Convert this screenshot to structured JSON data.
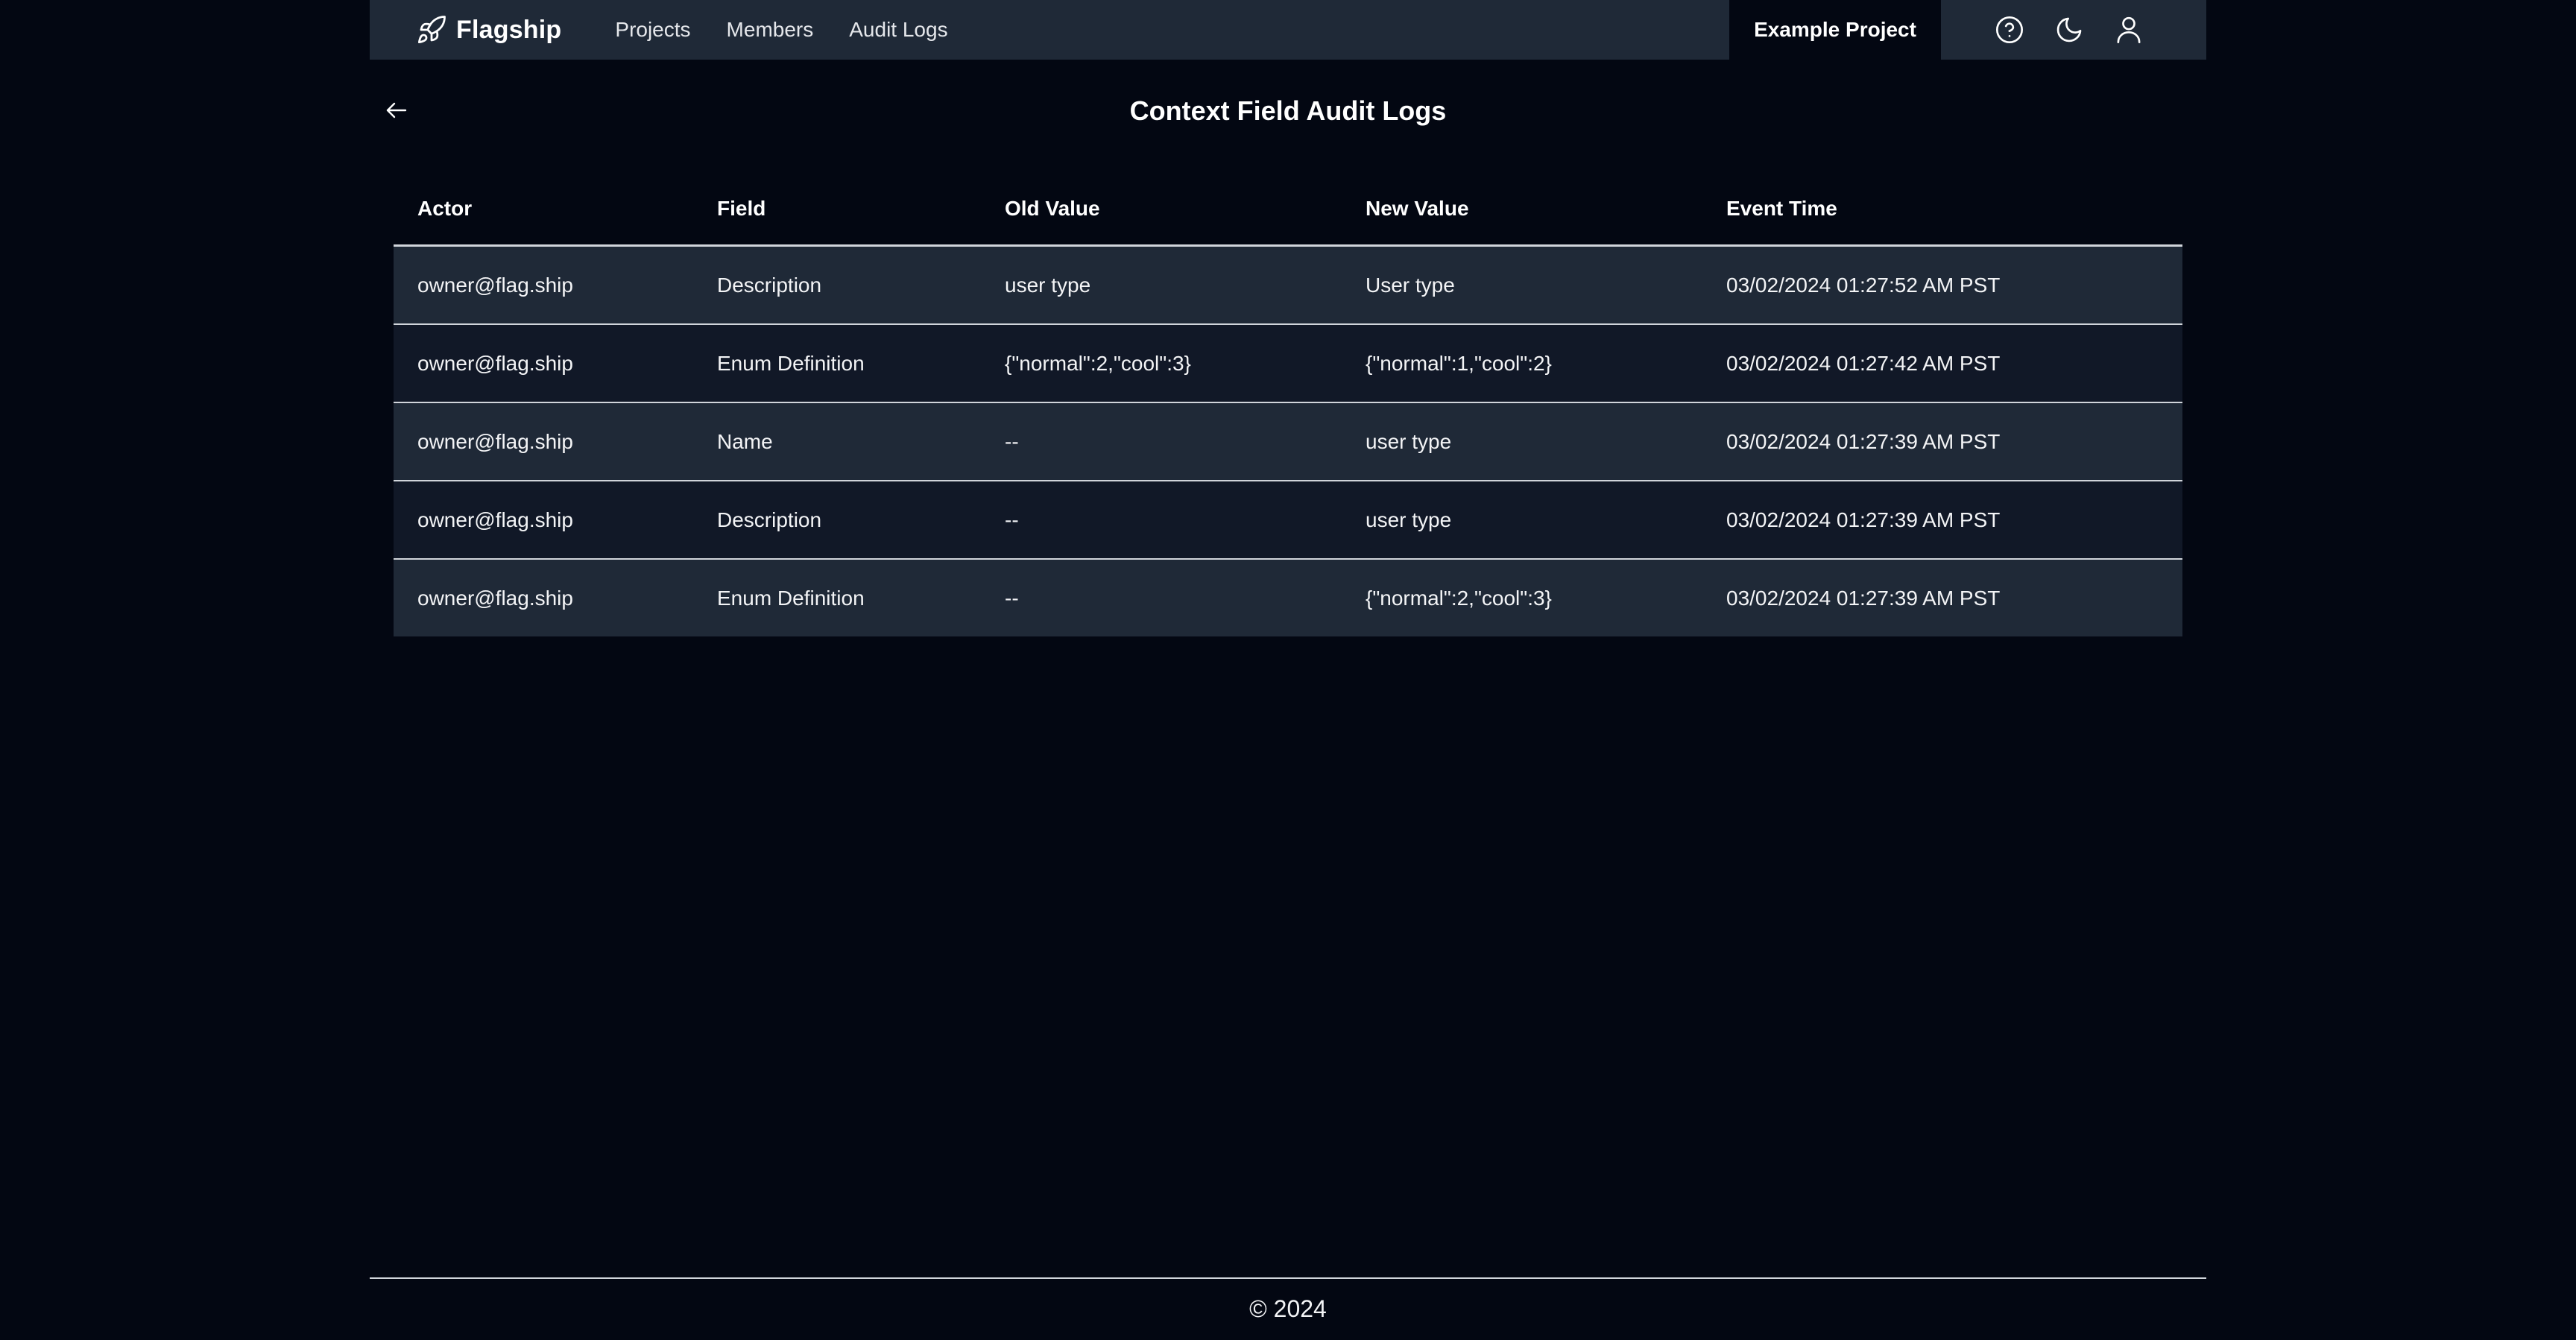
{
  "navbar": {
    "brand_name": "Flagship",
    "brand_icon": "rocket-icon",
    "links": [
      {
        "label": "Projects"
      },
      {
        "label": "Members"
      },
      {
        "label": "Audit Logs"
      }
    ],
    "project_name": "Example Project",
    "icons": [
      "help-circle-icon",
      "moon-icon",
      "user-icon"
    ]
  },
  "page": {
    "title": "Context Field Audit Logs",
    "back_icon": "arrow-left-icon"
  },
  "table": {
    "columns": [
      "Actor",
      "Field",
      "Old Value",
      "New Value",
      "Event Time"
    ],
    "rows": [
      [
        "owner@flag.ship",
        "Description",
        "user type",
        "User type",
        "03/02/2024 01:27:52 AM PST"
      ],
      [
        "owner@flag.ship",
        "Enum Definition",
        "{\"normal\":2,\"cool\":3}",
        "{\"normal\":1,\"cool\":2}",
        "03/02/2024 01:27:42 AM PST"
      ],
      [
        "owner@flag.ship",
        "Name",
        "--",
        "user type",
        "03/02/2024 01:27:39 AM PST"
      ],
      [
        "owner@flag.ship",
        "Description",
        "--",
        "user type",
        "03/02/2024 01:27:39 AM PST"
      ],
      [
        "owner@flag.ship",
        "Enum Definition",
        "--",
        "{\"normal\":2,\"cool\":3}",
        "03/02/2024 01:27:39 AM PST"
      ]
    ]
  },
  "footer": {
    "text": "© 2024"
  },
  "colors": {
    "background": "#030712",
    "navbar": "#1f2937",
    "row_odd": "#1f2937",
    "row_even": "#111827",
    "divider": "#d1d5db"
  }
}
